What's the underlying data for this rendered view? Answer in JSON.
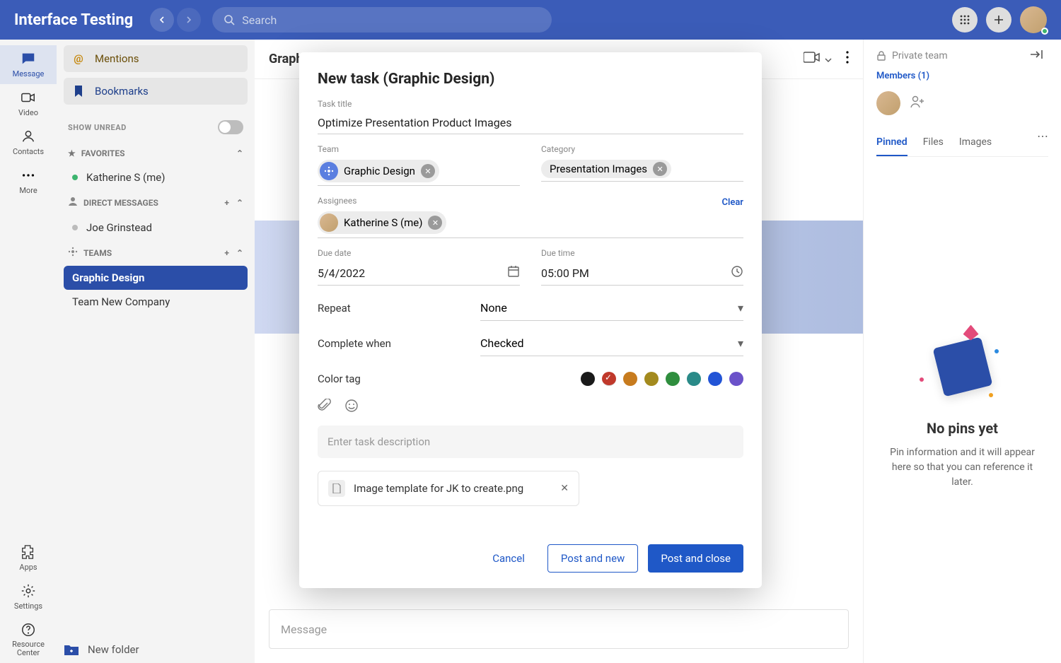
{
  "topbar": {
    "title": "Interface Testing",
    "search_placeholder": "Search"
  },
  "leftbar": {
    "items": [
      "Message",
      "Video",
      "Contacts",
      "More"
    ],
    "bottom": [
      "Apps",
      "Settings",
      "Resource Center"
    ]
  },
  "sidepanel": {
    "mentions": "Mentions",
    "bookmarks": "Bookmarks",
    "show_unread": "SHOW UNREAD",
    "favorites": "FAVORITES",
    "favorites_items": [
      "Katherine S (me)"
    ],
    "dms_hdr": "DIRECT MESSAGES",
    "dms_items": [
      "Joe Grinstead"
    ],
    "teams_hdr": "TEAMS",
    "teams_items": [
      "Graphic Design",
      "Team New Company"
    ],
    "new_folder": "New folder"
  },
  "chat": {
    "header": "Graphic Design",
    "msg_placeholder": "Message"
  },
  "rightpanel": {
    "private": "Private team",
    "members": "Members (1)",
    "tabs": [
      "Pinned",
      "Files",
      "Images"
    ],
    "empty_title": "No pins yet",
    "empty_body": "Pin information and it will appear here so that you can reference it later."
  },
  "modal": {
    "title": "New task (Graphic Design)",
    "task_title_label": "Task title",
    "task_title_value": "Optimize Presentation Product Images",
    "team_label": "Team",
    "team_chip": "Graphic Design",
    "category_label": "Category",
    "category_chip": "Presentation Images",
    "assignees_label": "Assignees",
    "assignee_chip": "Katherine S (me)",
    "clear": "Clear",
    "due_date_label": "Due date",
    "due_date_value": "5/4/2022",
    "due_time_label": "Due time",
    "due_time_value": "05:00 PM",
    "repeat_label": "Repeat",
    "repeat_value": "None",
    "complete_label": "Complete when",
    "complete_value": "Checked",
    "color_label": "Color tag",
    "colors": [
      "#1a1a1a",
      "#c0392b",
      "#c77b1e",
      "#a38a1e",
      "#2f8e3e",
      "#2a8a88",
      "#2254d6",
      "#6b52c9"
    ],
    "selected_color_index": 1,
    "desc_placeholder": "Enter task description",
    "attachment": "Image template for JK to create.png",
    "cancel": "Cancel",
    "post_new": "Post and new",
    "post_close": "Post and close"
  }
}
